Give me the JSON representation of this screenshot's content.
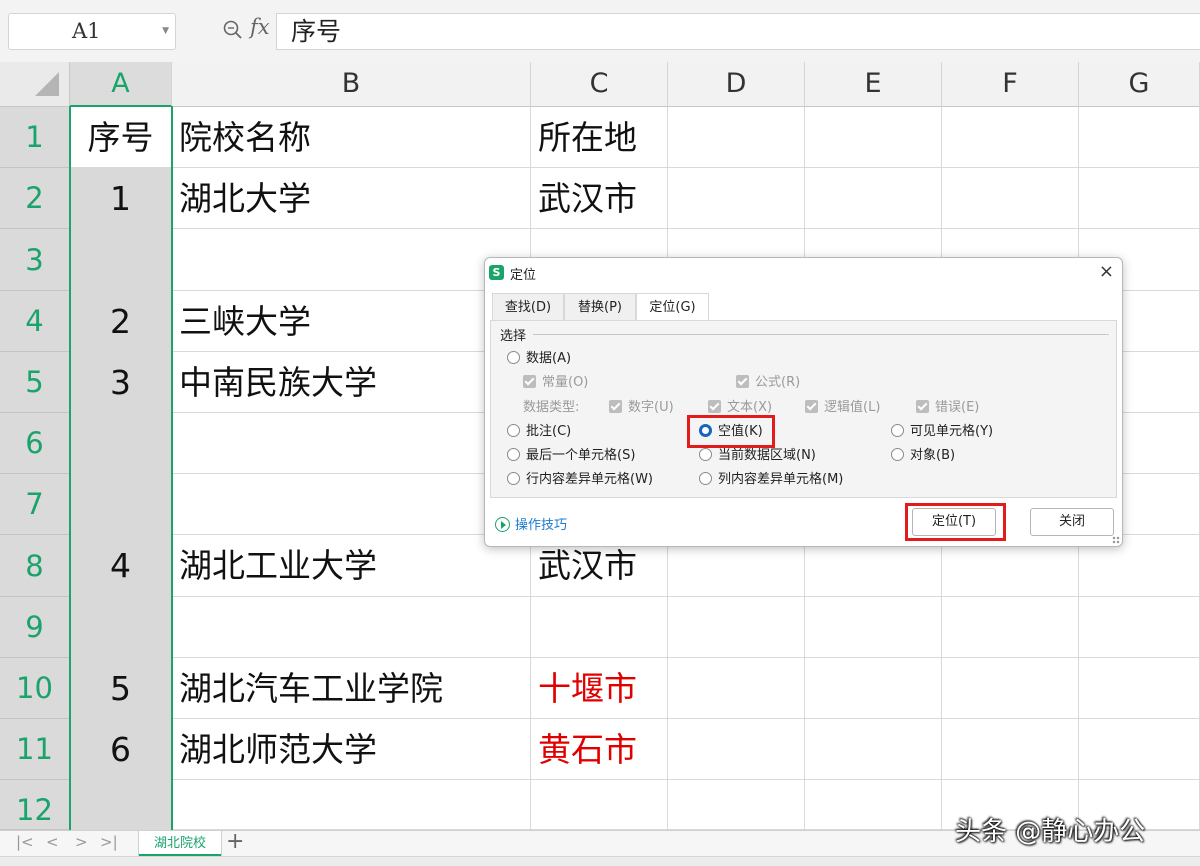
{
  "formula_bar": {
    "cell_ref": "A1",
    "fx_label": "fx",
    "content": "序号"
  },
  "columns": [
    "A",
    "B",
    "C",
    "D",
    "E",
    "F",
    "G"
  ],
  "rows": [
    {
      "num": "1",
      "a": "序号",
      "b": "院校名称",
      "c": "所在地"
    },
    {
      "num": "2",
      "a": "1",
      "b": "湖北大学",
      "c": "武汉市"
    },
    {
      "num": "3",
      "a": "",
      "b": "",
      "c": ""
    },
    {
      "num": "4",
      "a": "2",
      "b": "三峡大学",
      "c": ""
    },
    {
      "num": "5",
      "a": "3",
      "b": "中南民族大学",
      "c": ""
    },
    {
      "num": "6",
      "a": "",
      "b": "",
      "c": ""
    },
    {
      "num": "7",
      "a": "",
      "b": "",
      "c": ""
    },
    {
      "num": "8",
      "a": "4",
      "b": "湖北工业大学",
      "c": "武汉市"
    },
    {
      "num": "9",
      "a": "",
      "b": "",
      "c": ""
    },
    {
      "num": "10",
      "a": "5",
      "b": "湖北汽车工业学院",
      "c": "十堰市"
    },
    {
      "num": "11",
      "a": "6",
      "b": "湖北师范大学",
      "c": "黄石市"
    },
    {
      "num": "12",
      "a": "",
      "b": "",
      "c": ""
    }
  ],
  "red_text_color": "#e00000",
  "accent_color": "#1aa36b",
  "sheet_tabs": {
    "active": "湖北院校",
    "add": "+"
  },
  "watermark": "头条 @静心办公",
  "dialog": {
    "title": "定位",
    "logo": "S",
    "close": "×",
    "tabs": [
      "查找(D)",
      "替换(P)",
      "定位(G)"
    ],
    "section": "选择",
    "options": {
      "data": "数据(A)",
      "constant": "常量(O)",
      "formula": "公式(R)",
      "data_type": "数据类型:",
      "number": "数字(U)",
      "text": "文本(X)",
      "logic": "逻辑值(L)",
      "error": "错误(E)",
      "comment": "批注(C)",
      "empty": "空值(K)",
      "visible": "可见单元格(Y)",
      "last_cell": "最后一个单元格(S)",
      "current_region": "当前数据区域(N)",
      "object": "对象(B)",
      "row_diff": "行内容差异单元格(W)",
      "col_diff": "列内容差异单元格(M)"
    },
    "selected_option": "空值(K)",
    "tips": "操作技巧",
    "ok": "定位(T)",
    "close_btn": "关闭"
  }
}
